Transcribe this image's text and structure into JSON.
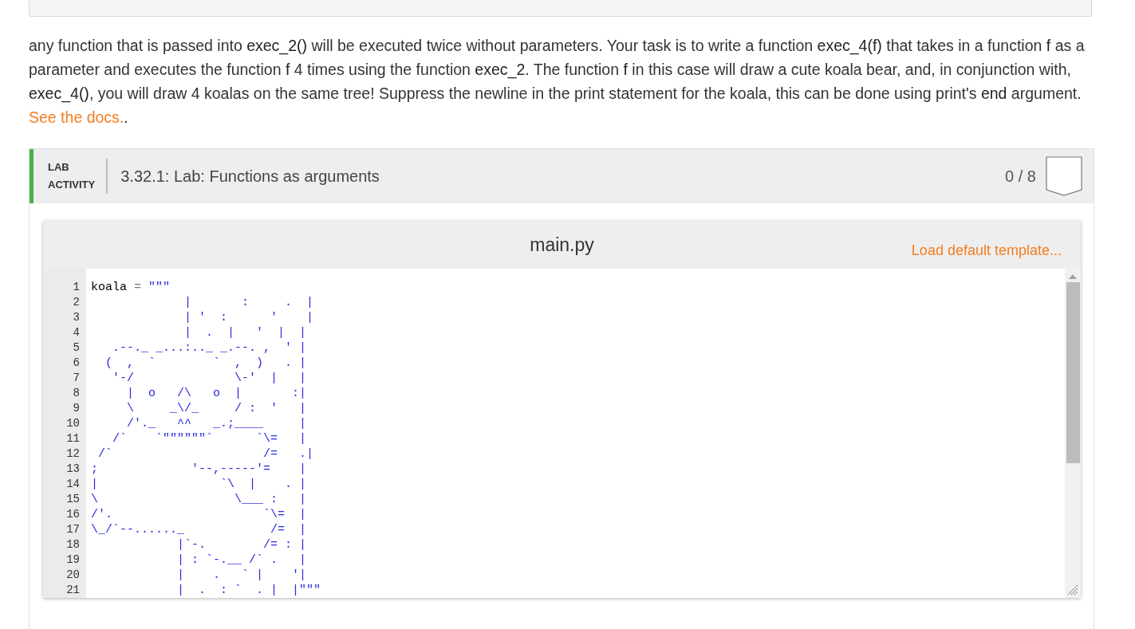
{
  "instructions": {
    "text": "any function that is passed into **exec_2()** will be executed twice without parameters. Your task is to write a function **exec_4(f)** that takes in a function **f** as a parameter and executes the function **f** 4 times using the function **exec_2**. The function **f** in this case will draw a cute koala bear, and, in conjunction with, **exec_4()**, you will draw 4 koalas on the same tree! Suppress the newline in the print statement for the koala, this can be done using print's **end** argument. ",
    "link": "See the docs.",
    "after": "."
  },
  "lab": {
    "badge_line_1": "LAB",
    "badge_line_2": "ACTIVITY",
    "title": "3.32.1: Lab: Functions as arguments",
    "score": "0 / 8"
  },
  "editor": {
    "filename": "main.py",
    "template_link": "Load default template...",
    "lines": [
      {
        "number": "1",
        "tokens": [
          {
            "kind": "name",
            "text": "koala"
          },
          {
            "kind": "operator",
            "text": "="
          },
          {
            "kind": "string",
            "text": "\"\"\""
          }
        ]
      },
      {
        "number": "2",
        "tokens": [
          {
            "kind": "string",
            "text": "             |       :     .  |"
          }
        ]
      },
      {
        "number": "3",
        "tokens": [
          {
            "kind": "string",
            "text": "             | '  :      '    |"
          }
        ]
      },
      {
        "number": "4",
        "tokens": [
          {
            "kind": "string",
            "text": "             |  .  |   '  |  |"
          }
        ]
      },
      {
        "number": "5",
        "tokens": [
          {
            "kind": "string",
            "text": "   .--._ _...:.._ _.--. ,  ' |"
          }
        ]
      },
      {
        "number": "6",
        "tokens": [
          {
            "kind": "string",
            "text": "  (  ,  `        `  ,  )   . |"
          }
        ]
      },
      {
        "number": "7",
        "tokens": [
          {
            "kind": "string",
            "text": "   '-/              \\-'  |   |"
          }
        ]
      },
      {
        "number": "8",
        "tokens": [
          {
            "kind": "string",
            "text": "     |  o   /\\   o  |       :|"
          }
        ]
      },
      {
        "number": "9",
        "tokens": [
          {
            "kind": "string",
            "text": "     \\     _\\/_     / :  '   |"
          }
        ]
      },
      {
        "number": "10",
        "tokens": [
          {
            "kind": "string",
            "text": "     /'._   ^^   _.;____     |"
          }
        ]
      },
      {
        "number": "11",
        "tokens": [
          {
            "kind": "string",
            "text": "   /`    `\"\"\"\"\"\"`      `\\=   |"
          }
        ]
      },
      {
        "number": "12",
        "tokens": [
          {
            "kind": "string",
            "text": " /`                     /=   .|"
          }
        ]
      },
      {
        "number": "13",
        "tokens": [
          {
            "kind": "string",
            "text": ";             '--,-----'=    |"
          }
        ]
      },
      {
        "number": "14",
        "tokens": [
          {
            "kind": "string",
            "text": "|                 `\\  |    . |"
          }
        ]
      },
      {
        "number": "15",
        "tokens": [
          {
            "kind": "string",
            "text": "\\                   \\___ :   |"
          }
        ]
      },
      {
        "number": "16",
        "tokens": [
          {
            "kind": "string",
            "text": "/'.                     `\\=  |"
          }
        ]
      },
      {
        "number": "17",
        "tokens": [
          {
            "kind": "string",
            "text": "\\_/`--......_            /=  |"
          }
        ]
      },
      {
        "number": "18",
        "tokens": [
          {
            "kind": "string",
            "text": "            |`-.        /= : |"
          }
        ]
      },
      {
        "number": "19",
        "tokens": [
          {
            "kind": "string",
            "text": "            | : `-.__ /` .   |"
          }
        ]
      },
      {
        "number": "20",
        "tokens": [
          {
            "kind": "string",
            "text": "            |    .   ` |    '|"
          }
        ]
      },
      {
        "number": "21",
        "tokens": [
          {
            "kind": "string",
            "text": "            |  .  : `  . |  |\"\"\""
          }
        ]
      }
    ]
  }
}
